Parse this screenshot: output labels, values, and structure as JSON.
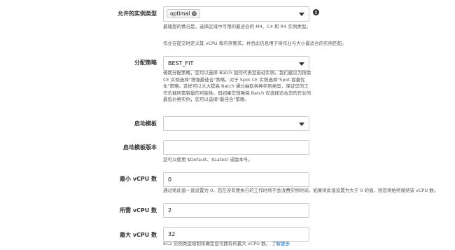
{
  "instance_types": {
    "label": "允许的实例类型",
    "token": "optimal",
    "help_1": "最理想的情况是，选择区域中可用的最适合的 M4、C4 和 R4 实例类型。",
    "help_2": "作业在提交时定义其 vCPU 和内存要求，并且此信息用于将作业与大小最适合的实例匹配。"
  },
  "allocation_strategy": {
    "label": "分配策略",
    "value": "BEST_FIT",
    "help": "借助分配策略，您可以选择 Batch 如何代表您启动实例。我们建议为按需 CE 实例选择\"增强最佳合\"策略，对于 Spot CE 实例选择\"Spot 容量优化\"策略。这样可以大大提高 Batch 通过抽取各种实例类型，保证您的工作负载所需容量的可能性。但如果您想确保 Batch 仅选择适合您的作业的最低价格实例，您可以选择\"最佳合\"策略。"
  },
  "launch_template": {
    "label": "启动模板",
    "value": ""
  },
  "launch_template_version": {
    "label": "启动模板版本",
    "value": "",
    "help": "您可以使用 $Default、$Latest 或版本号。"
  },
  "min_vcpu": {
    "label": "最小 vCPU 数",
    "value": "0",
    "help": "通过将此值一直设置为 0，您在没有要执行的工作时将不会浪费实例时间。如果将此值设置为大于 0 的值，则您将始终保持该 vCPU 数。"
  },
  "desired_vcpu": {
    "label": "所需 vCPU 数",
    "value": "2"
  },
  "max_vcpu": {
    "label": "最大 vCPU 数",
    "value": "32",
    "help": "EC2 实例类型限制将确定您可拥有的最大 vCPU 数。",
    "link": "了解更多"
  },
  "colors": {
    "link": "#1166bb",
    "border": "#c9cbcf"
  },
  "icons": {
    "info": "info-circle-icon",
    "dropdown": "caret-down-icon",
    "remove_token": "x-circle-icon"
  }
}
